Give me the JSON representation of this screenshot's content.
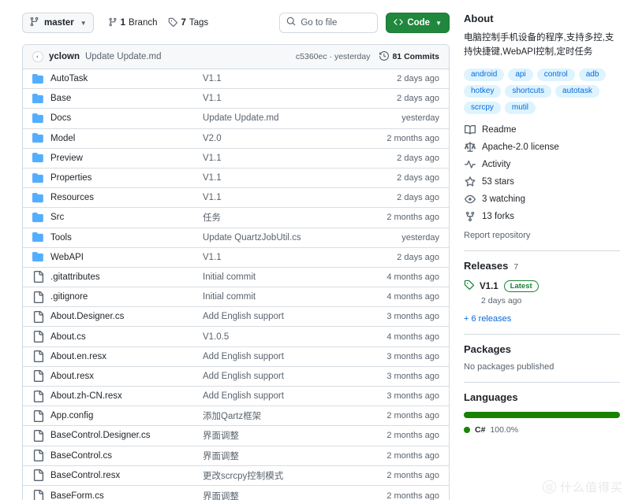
{
  "toolbar": {
    "branch_name": "master",
    "branch_icon": "branch-icon",
    "branches_count": "1",
    "branches_label": "Branch",
    "tags_count": "7",
    "tags_label": "Tags",
    "search_placeholder": "Go to file",
    "search_value": "",
    "code_button": "Code"
  },
  "commit_bar": {
    "author": "yclown",
    "message": "Update Update.md",
    "sha": "c5360ec",
    "sha_separator": "·",
    "date": "yesterday",
    "commits_count": "81 Commits"
  },
  "files": [
    {
      "type": "folder",
      "name": "AutoTask",
      "message": "V1.1",
      "age": "2 days ago"
    },
    {
      "type": "folder",
      "name": "Base",
      "message": "V1.1",
      "age": "2 days ago"
    },
    {
      "type": "folder",
      "name": "Docs",
      "message": "Update Update.md",
      "age": "yesterday"
    },
    {
      "type": "folder",
      "name": "Model",
      "message": "V2.0",
      "age": "2 months ago"
    },
    {
      "type": "folder",
      "name": "Preview",
      "message": "V1.1",
      "age": "2 days ago"
    },
    {
      "type": "folder",
      "name": "Properties",
      "message": "V1.1",
      "age": "2 days ago"
    },
    {
      "type": "folder",
      "name": "Resources",
      "message": "V1.1",
      "age": "2 days ago"
    },
    {
      "type": "folder",
      "name": "Src",
      "message": "任务",
      "age": "2 months ago"
    },
    {
      "type": "folder",
      "name": "Tools",
      "message": "Update QuartzJobUtil.cs",
      "age": "yesterday"
    },
    {
      "type": "folder",
      "name": "WebAPI",
      "message": "V1.1",
      "age": "2 days ago"
    },
    {
      "type": "file",
      "name": ".gitattributes",
      "message": "Initial commit",
      "age": "4 months ago"
    },
    {
      "type": "file",
      "name": ".gitignore",
      "message": "Initial commit",
      "age": "4 months ago"
    },
    {
      "type": "file",
      "name": "About.Designer.cs",
      "message": "Add English support",
      "age": "3 months ago"
    },
    {
      "type": "file",
      "name": "About.cs",
      "message": "V1.0.5",
      "age": "4 months ago"
    },
    {
      "type": "file",
      "name": "About.en.resx",
      "message": "Add English support",
      "age": "3 months ago"
    },
    {
      "type": "file",
      "name": "About.resx",
      "message": "Add English support",
      "age": "3 months ago"
    },
    {
      "type": "file",
      "name": "About.zh-CN.resx",
      "message": "Add English support",
      "age": "3 months ago"
    },
    {
      "type": "file",
      "name": "App.config",
      "message": "添加Qartz框架",
      "age": "2 months ago"
    },
    {
      "type": "file",
      "name": "BaseControl.Designer.cs",
      "message": "界面调整",
      "age": "2 months ago"
    },
    {
      "type": "file",
      "name": "BaseControl.cs",
      "message": "界面调整",
      "age": "2 months ago"
    },
    {
      "type": "file",
      "name": "BaseControl.resx",
      "message": "更改scrcpy控制模式",
      "age": "2 months ago"
    },
    {
      "type": "file",
      "name": "BaseForm.cs",
      "message": "界面调整",
      "age": "2 months ago"
    }
  ],
  "about": {
    "title": "About",
    "description": "电脑控制手机设备的程序,支持多控,支持快捷键,WebAPI控制,定时任务",
    "topics": [
      "android",
      "api",
      "control",
      "adb",
      "hotkey",
      "shortcuts",
      "autotask",
      "scrcpy",
      "mutil"
    ],
    "links": [
      {
        "icon": "book-icon",
        "label": "Readme"
      },
      {
        "icon": "law-icon",
        "label": "Apache-2.0 license"
      },
      {
        "icon": "pulse-icon",
        "label": "Activity"
      },
      {
        "icon": "star-icon",
        "label": "53 stars"
      },
      {
        "icon": "eye-icon",
        "label": "3 watching"
      },
      {
        "icon": "fork-icon",
        "label": "13 forks"
      }
    ],
    "report": "Report repository"
  },
  "releases": {
    "title": "Releases",
    "count": "7",
    "latest_tag": "V1.1",
    "latest_badge": "Latest",
    "latest_date": "2 days ago",
    "more": "+ 6 releases"
  },
  "packages": {
    "title": "Packages",
    "empty": "No packages published"
  },
  "languages": {
    "title": "Languages",
    "items": [
      {
        "name": "C#",
        "percent": "100.0%",
        "color": "#178600",
        "bar_color": "#1a8101"
      }
    ]
  },
  "watermark": {
    "mark": "值",
    "text": "什么值得买"
  },
  "colors": {
    "accent_green": "#1f883d",
    "link_blue": "#0969da",
    "folder_blue": "#54aeff",
    "topic_bg": "#ddf4ff",
    "border": "#d1d9e0"
  }
}
